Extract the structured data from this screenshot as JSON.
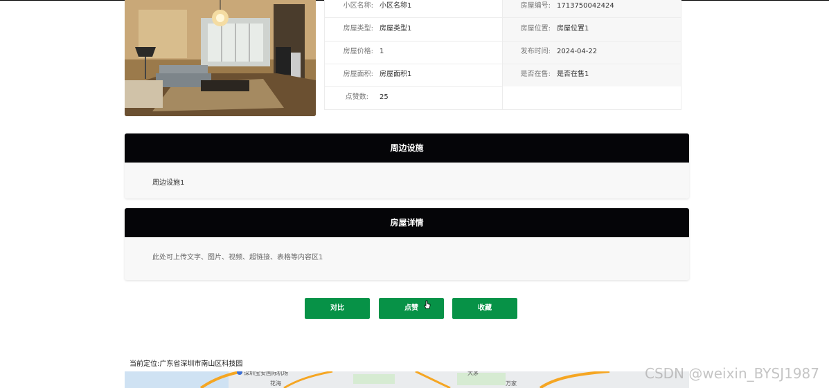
{
  "info": {
    "left": [
      {
        "label": "小区名称:",
        "value": "小区名称1"
      },
      {
        "label": "房屋类型:",
        "value": "房屋类型1"
      },
      {
        "label": "房屋价格:",
        "value": "1"
      },
      {
        "label": "房屋面积:",
        "value": "房屋面积1"
      },
      {
        "label": "点赞数:",
        "value": "25"
      }
    ],
    "right": [
      {
        "label": "房屋编号:",
        "value": "1713750042424"
      },
      {
        "label": "房屋位置:",
        "value": "房屋位置1"
      },
      {
        "label": "发布时间:",
        "value": "2024-04-22"
      },
      {
        "label": "是否在售:",
        "value": "是否在售1"
      }
    ]
  },
  "panels": {
    "surroundings": {
      "title": "周边设施",
      "content": "周边设施1"
    },
    "details": {
      "title": "房屋详情",
      "content": "此处可上传文字、图片、视频、超链接、表格等内容区1"
    }
  },
  "buttons": {
    "compare": "对比",
    "like": "点赞",
    "favorite": "收藏"
  },
  "location": "当前定位:广东省深圳市南山区科技园",
  "map": {
    "labels": [
      "深圳宝安国际机场",
      "花海",
      "大茅",
      "万家"
    ],
    "accent": "#f5a623"
  },
  "watermark": "CSDN @weixin_BYSJ1987",
  "colors": {
    "button": "#079247",
    "panel_header": "#050508"
  }
}
